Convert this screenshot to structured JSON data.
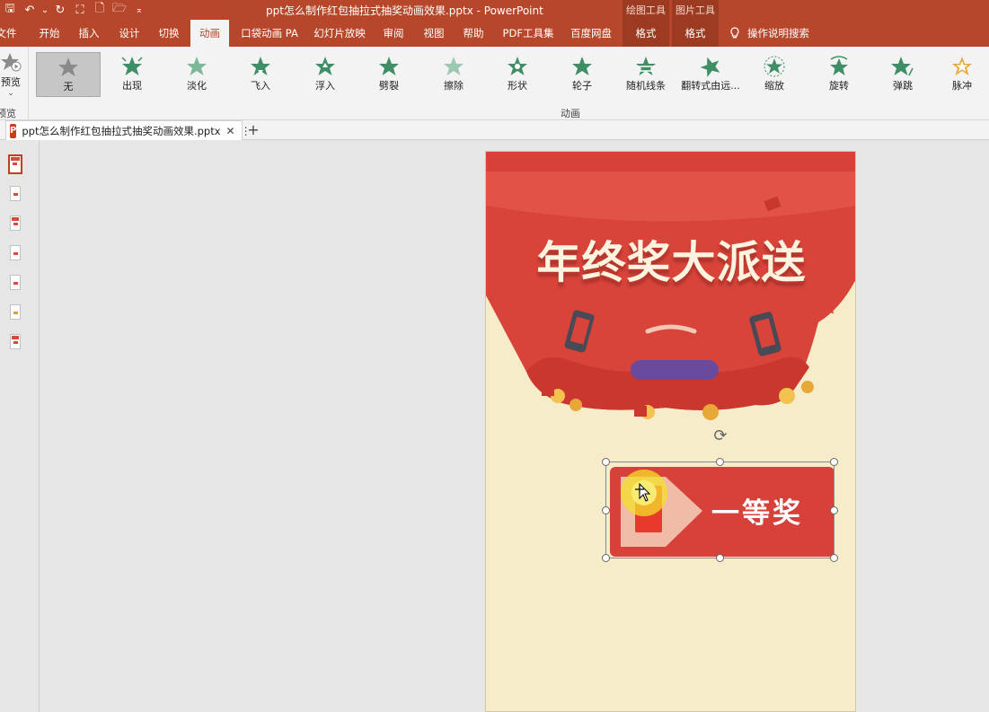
{
  "titlebar": {
    "quick_access": [
      {
        "name": "save-icon",
        "glyph": "🖫"
      },
      {
        "name": "undo-icon",
        "glyph": "↶"
      },
      {
        "name": "undo-dropdown-icon",
        "glyph": "⌄"
      },
      {
        "name": "redo-icon",
        "glyph": "↻"
      },
      {
        "name": "present-icon",
        "glyph": "⛶"
      },
      {
        "name": "new-file-icon",
        "glyph": "🗋"
      },
      {
        "name": "open-folder-icon",
        "glyph": "🗁"
      },
      {
        "name": "customize-qat-icon",
        "glyph": "⌅"
      }
    ],
    "title": "ppt怎么制作红包抽拉式抽奖动画效果.pptx  -  PowerPoint",
    "context_groups": [
      "绘图工具",
      "图片工具"
    ]
  },
  "tabs": {
    "items": [
      "文件",
      "开始",
      "插入",
      "设计",
      "切换",
      "动画",
      "口袋动画 PA",
      "幻灯片放映",
      "审阅",
      "视图",
      "帮助",
      "PDF工具集",
      "百度网盘",
      "格式",
      "格式"
    ],
    "active": "动画",
    "tell_me": "操作说明搜索"
  },
  "ribbon": {
    "preview_label": "预览",
    "preview_caption": "预览",
    "group_caption": "动画",
    "animations": [
      "无",
      "出现",
      "淡化",
      "飞入",
      "浮入",
      "劈裂",
      "擦除",
      "形状",
      "轮子",
      "随机线条",
      "翻转式由远...",
      "缩放",
      "旋转",
      "弹跳",
      "脉冲"
    ],
    "selected": "无",
    "accent_color": "#3e8f66"
  },
  "document_tab": {
    "title": "ppt怎么制作红包抽拉式抽奖动画效果.pptx",
    "close_glyph": "✕",
    "more_glyph": "⋮",
    "new_tab_glyph": "+"
  },
  "slide": {
    "headline": "年终奖大派送",
    "prize_label": "一等奖"
  },
  "colors": {
    "brand": "#b7472a",
    "envelope_red": "#d8433a",
    "slide_background": "#f7ecc9",
    "button_purple": "#6a4a9c"
  }
}
